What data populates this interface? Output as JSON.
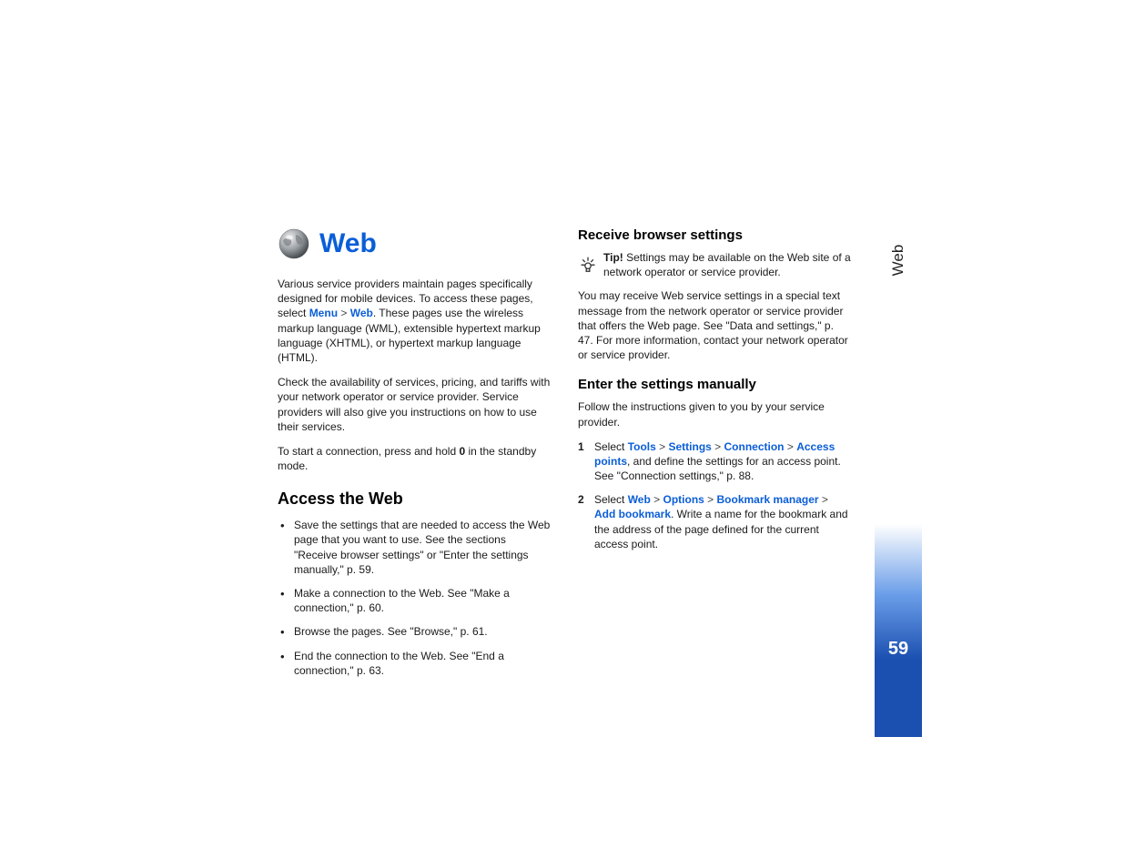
{
  "chapter": {
    "title": "Web"
  },
  "sidebar": {
    "label": "Web",
    "page_number": "59"
  },
  "col1": {
    "intro": {
      "p1_a": "Various service providers maintain pages specifically designed for mobile devices. To access these pages, select ",
      "menu": "Menu",
      "sep": " > ",
      "web": "Web",
      "p1_b": ". These pages use the wireless markup language (WML), extensible hypertext markup language (XHTML), or hypertext markup language (HTML).",
      "p2": "Check the availability of services, pricing, and tariffs with your network operator or service provider. Service providers will also give you instructions on how to use their services.",
      "p3_a": "To start a connection, press and hold ",
      "key0": "0",
      "p3_b": " in the standby mode."
    },
    "h2": "Access the Web",
    "bullets": [
      "Save the settings that are needed to access the Web page that you want to use. See the sections \"Receive browser settings\" or \"Enter the settings manually,\" p. 59.",
      "Make a connection to the Web. See \"Make a connection,\" p. 60.",
      "Browse the pages. See \"Browse,\" p. 61.",
      "End the connection to the Web. See \"End a connection,\" p. 63."
    ]
  },
  "col2": {
    "h3a": "Receive browser settings",
    "tip": {
      "label": "Tip!",
      "text": " Settings may be available on the Web site of a network operator or service provider."
    },
    "p1": "You may receive Web service settings in a special text message from the network operator or service provider that offers the Web page. See \"Data and settings,\" p. 47. For more information, contact your network operator or service provider.",
    "h3b": "Enter the settings manually",
    "p2": "Follow the instructions given to you by your service provider.",
    "steps": [
      {
        "num": "1",
        "pre": "Select ",
        "links": [
          "Tools",
          "Settings",
          "Connection",
          "Access points"
        ],
        "post": ", and define the settings for an access point. See \"Connection settings,\" p. 88."
      },
      {
        "num": "2",
        "pre": "Select ",
        "links": [
          "Web",
          "Options",
          "Bookmark manager",
          "Add bookmark"
        ],
        "post": ". Write a name for the bookmark and the address of the page defined for the current access point."
      }
    ]
  }
}
